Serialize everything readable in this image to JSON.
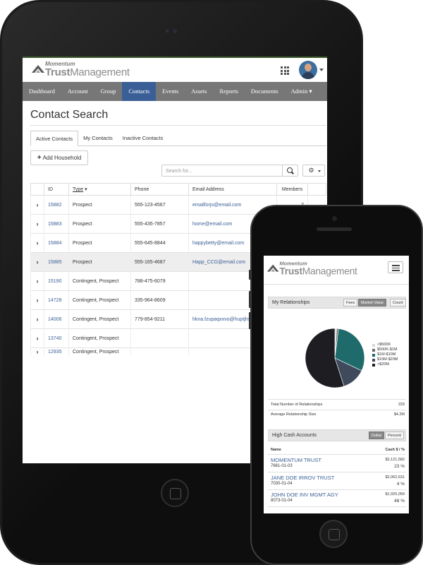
{
  "tablet": {
    "logo": {
      "top": "Momentum",
      "trust": "Trust",
      "management": "Management"
    },
    "nav": [
      "Dashboard",
      "Account",
      "Group",
      "Contacts",
      "Events",
      "Assets",
      "Reports",
      "Documents",
      "Admin"
    ],
    "active_nav": "Contacts",
    "page_title": "Contact Search",
    "tabs": [
      "Active Contacts",
      "My Contacts",
      "Inactive Contacts"
    ],
    "add_household": "Add Household",
    "search_placeholder": "Search for...",
    "table": {
      "headers": [
        "ID",
        "Type",
        "Phone",
        "Email Address",
        "Members"
      ],
      "rows": [
        {
          "id": "15882",
          "type": "Prospect",
          "phone": "555-123-4567",
          "email": "emailforjo@email.com",
          "members": "2"
        },
        {
          "id": "15883",
          "type": "Prospect",
          "phone": "555-435-7857",
          "email": "home@email.com",
          "members": ""
        },
        {
          "id": "15884",
          "type": "Prospect",
          "phone": "555-645-8844",
          "email": "happybetty@email.com",
          "members": ""
        },
        {
          "id": "15885",
          "type": "Prospect",
          "phone": "555-165-4687",
          "email": "Happ_CCG@email.com",
          "members": ""
        },
        {
          "id": "15190",
          "type": "Contingent, Prospect",
          "phone": "788-475-6079",
          "email": "",
          "members": ""
        },
        {
          "id": "14728",
          "type": "Contingent, Prospect",
          "phone": "335-964-8609",
          "email": "",
          "members": ""
        },
        {
          "id": "14006",
          "type": "Contingent, Prospect",
          "phone": "779-854-9211",
          "email": "hkna.fzupaqxxvo@huptjhs.b",
          "members": ""
        },
        {
          "id": "13740",
          "type": "Contingent, Prospect",
          "phone": "",
          "email": "",
          "members": ""
        },
        {
          "id": "12935",
          "type": "Contingent, Prospect",
          "phone": "",
          "email": "",
          "members": ""
        }
      ]
    }
  },
  "phone": {
    "logo": {
      "top": "Momentum",
      "trust": "Trust",
      "management": "Management"
    },
    "relationships": {
      "title": "My Relationships",
      "toggles": [
        "Fees",
        "Market Value",
        "Count"
      ],
      "active_toggle": "Market Value"
    },
    "chart_data": {
      "type": "pie",
      "categories": [
        "<$500K",
        "$500K-$1M",
        "$1M-$10M",
        "$10M-$20M",
        ">$20M"
      ],
      "values": [
        1,
        1,
        30,
        13,
        55
      ],
      "colors": [
        "#d8d8d8",
        "#6b6b6b",
        "#1f6a6b",
        "#3f4a5c",
        "#1e1e22"
      ]
    },
    "stats": [
      {
        "label": "Total Number of Relationships",
        "value": "229"
      },
      {
        "label": "Average Relationship Size",
        "value": "$4.2M"
      }
    ],
    "high_cash": {
      "title": "High Cash Accounts",
      "toggles": [
        "Dollar",
        "Percent"
      ],
      "active_toggle": "Dollar",
      "col_name": "Name",
      "col_cash": "Cash $ / %",
      "accounts": [
        {
          "name": "MOMENTUM TRUST",
          "id": "7661-01-03",
          "amount": "$2,121,582",
          "pct": "23 %"
        },
        {
          "name": "JANE DOE IRROV TRUST",
          "id": "7030-01-04",
          "amount": "$2,062,631",
          "pct": "4 %"
        },
        {
          "name": "JOHN DOE INV MGMT AGY",
          "id": "8073-01-04",
          "amount": "$1,925,059",
          "pct": "48 %"
        }
      ]
    }
  }
}
